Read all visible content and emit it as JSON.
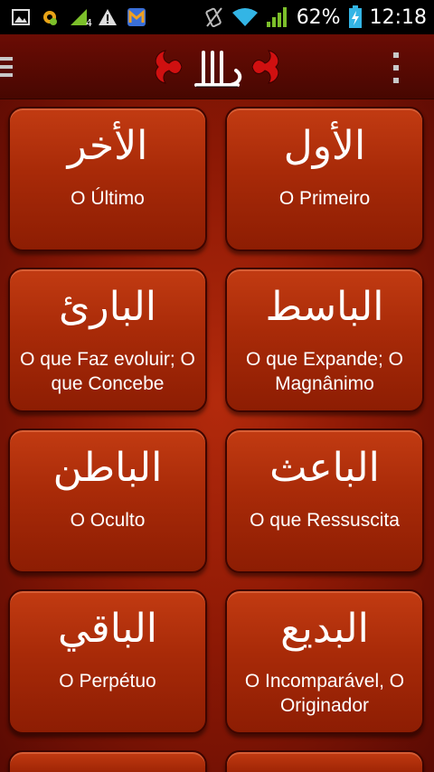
{
  "status_bar": {
    "battery_percent": "62%",
    "time": "12:18",
    "icons": [
      "image-icon",
      "settings-cog-icon",
      "signal-4-icon",
      "warning-icon",
      "app-m-icon",
      "silent-icon",
      "wifi-icon",
      "cell-signal-icon",
      "battery-charging-icon"
    ],
    "notification_badge": "4"
  },
  "app_bar": {
    "logo_icon": "allah-calligraphy-logo",
    "menu_icon": "hamburger-menu-icon",
    "overflow_icon": "overflow-menu-icon"
  },
  "names": [
    {
      "arabic": "الأخر",
      "meaning": "O Último"
    },
    {
      "arabic": "الأول",
      "meaning": "O Primeiro"
    },
    {
      "arabic": "البارئ",
      "meaning": "O que Faz evoluir; O que Concebe"
    },
    {
      "arabic": "الباسط",
      "meaning": "O que Expande; O Magnânimo"
    },
    {
      "arabic": "الباطن",
      "meaning": "O Oculto"
    },
    {
      "arabic": "الباعث",
      "meaning": "O que Ressuscita"
    },
    {
      "arabic": "الباقي",
      "meaning": "O Perpétuo"
    },
    {
      "arabic": "البديع",
      "meaning": "O Incomparável, O Originador"
    }
  ],
  "colors": {
    "background": "#8e1905",
    "card": "#a82a08",
    "app_bar": "#5a0a03",
    "text": "#ffffff"
  }
}
